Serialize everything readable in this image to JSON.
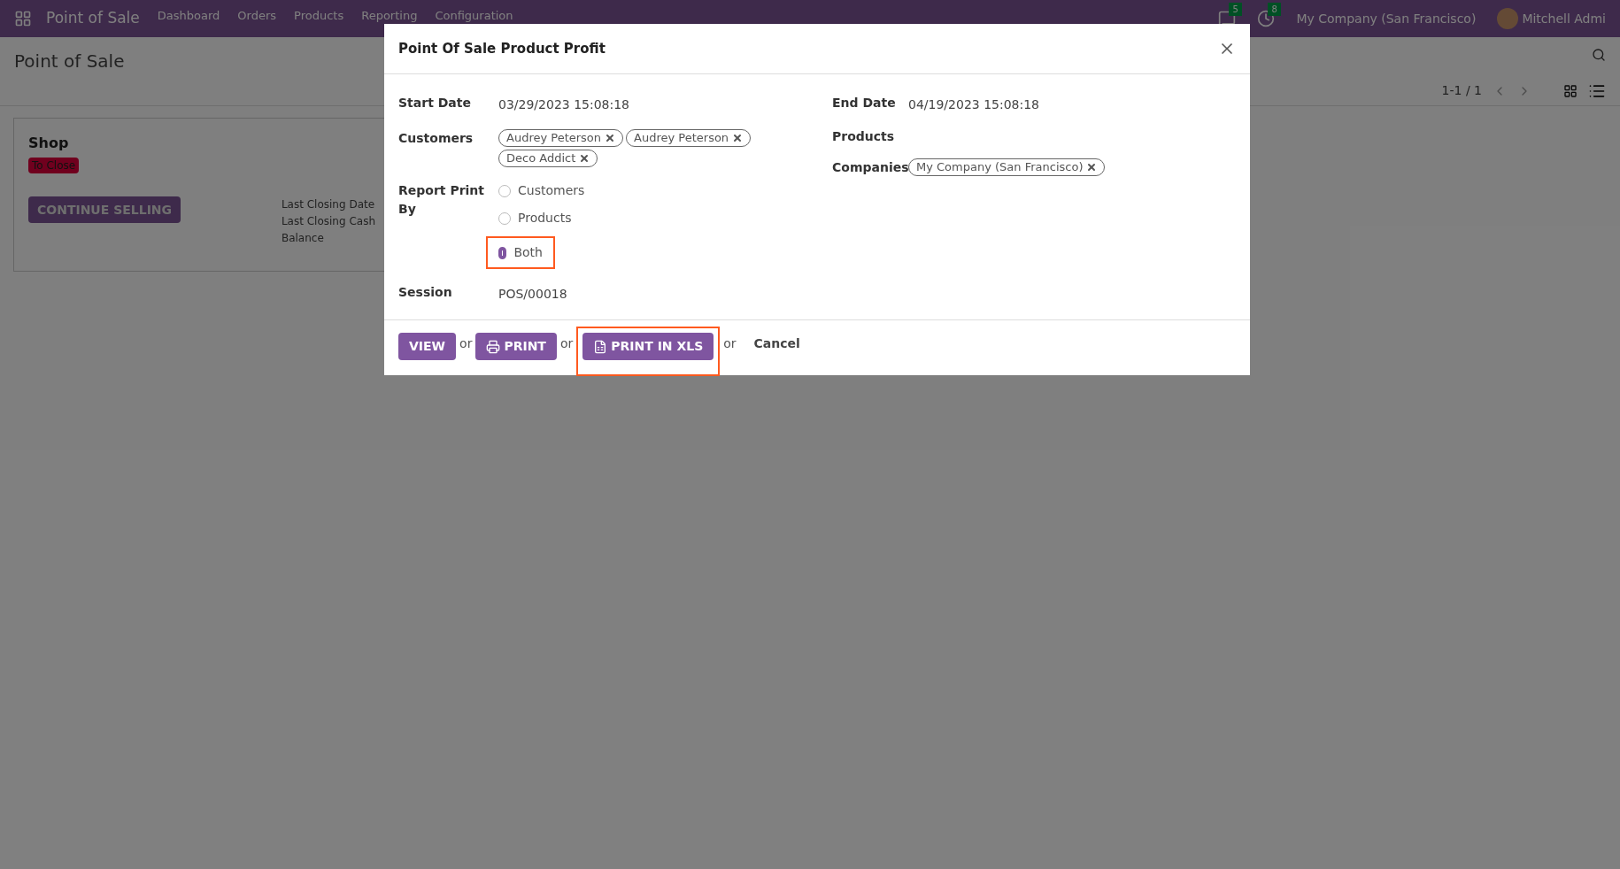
{
  "navbar": {
    "app_name": "Point of Sale",
    "menu": [
      "Dashboard",
      "Orders",
      "Products",
      "Reporting",
      "Configuration"
    ],
    "chat_count": "5",
    "activity_count": "8",
    "company": "My Company (San Francisco)",
    "user": "Mitchell Admi"
  },
  "breadcrumb": "Point of Sale",
  "pager": "1-1 / 1",
  "card": {
    "title": "Shop",
    "status": "To Close",
    "button": "CONTINUE SELLING",
    "info": [
      "Last Closing Date",
      "Last Closing Cash",
      "Balance"
    ]
  },
  "dialog": {
    "title": "Point Of Sale Product Profit",
    "left_fields": [
      {
        "kind": "text",
        "label": "Start Date",
        "value": "03/29/2023 15:08:18"
      },
      {
        "kind": "tags",
        "label": "Customers",
        "tags": [
          "Audrey Peterson",
          "Audrey Peterson",
          "Deco Addict"
        ]
      },
      {
        "kind": "radio",
        "label": "Report Print By",
        "options": [
          {
            "label": "Customers",
            "selected": false,
            "highlighted": false
          },
          {
            "label": "Products",
            "selected": false,
            "highlighted": false
          },
          {
            "label": "Both",
            "selected": true,
            "highlighted": true
          }
        ]
      },
      {
        "kind": "text",
        "label": "Session",
        "value": "POS/00018"
      }
    ],
    "right_fields": [
      {
        "kind": "text",
        "label": "End Date",
        "value": "04/19/2023 15:08:18"
      },
      {
        "kind": "tags",
        "label": "Products"
      },
      {
        "kind": "tags",
        "label": "Companies",
        "tags": [
          "My Company (San Francisco)"
        ]
      }
    ],
    "footer": [
      {
        "kind": "button",
        "label": "VIEW",
        "highlighted": false
      },
      {
        "kind": "separator",
        "label": "or"
      },
      {
        "kind": "print_button",
        "label": "PRINT",
        "highlighted": false
      },
      {
        "kind": "separator",
        "label": "or"
      },
      {
        "kind": "xls_button",
        "label": "PRINT IN XLS",
        "highlighted": true
      },
      {
        "kind": "separator",
        "label": "or"
      },
      {
        "kind": "link",
        "label": "Cancel"
      }
    ]
  }
}
